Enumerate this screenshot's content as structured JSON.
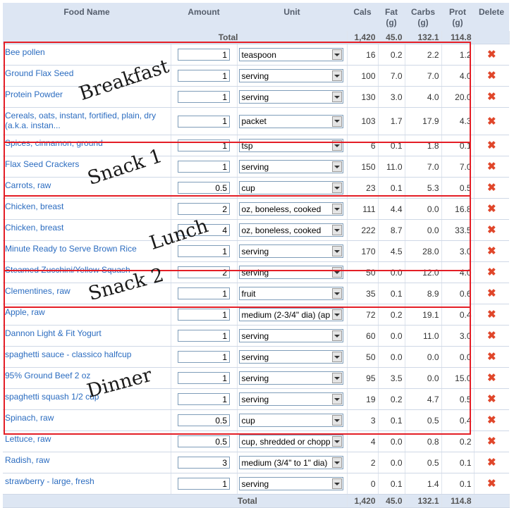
{
  "headers": {
    "food_name": "Food Name",
    "amount": "Amount",
    "unit": "Unit",
    "cals": "Cals",
    "fat": "Fat",
    "fat_unit": "(g)",
    "carbs": "Carbs",
    "carbs_unit": "(g)",
    "prot": "Prot",
    "prot_unit": "(g)",
    "delete": "Delete"
  },
  "total": {
    "label": "Total",
    "cals": "1,420",
    "fat": "45.0",
    "carbs": "132.1",
    "prot": "114.8"
  },
  "groups": {
    "breakfast": "Breakfast",
    "snack1": "Snack 1",
    "lunch": "Lunch",
    "snack2": "Snack 2",
    "dinner": "Dinner"
  },
  "rows": [
    {
      "name": "Bee pollen",
      "amount": "1",
      "unit": "teaspoon",
      "cals": "16",
      "fat": "0.2",
      "carbs": "2.2",
      "prot": "1.2"
    },
    {
      "name": "Ground Flax Seed",
      "amount": "1",
      "unit": "serving",
      "cals": "100",
      "fat": "7.0",
      "carbs": "7.0",
      "prot": "4.0"
    },
    {
      "name": "Protein Powder",
      "amount": "1",
      "unit": "serving",
      "cals": "130",
      "fat": "3.0",
      "carbs": "4.0",
      "prot": "20.0"
    },
    {
      "name": "Cereals, oats, instant, fortified, plain, dry (a.k.a. instan...",
      "amount": "1",
      "unit": "packet",
      "cals": "103",
      "fat": "1.7",
      "carbs": "17.9",
      "prot": "4.3"
    },
    {
      "name": "Spices, cinnamon, ground",
      "amount": "1",
      "unit": "tsp",
      "cals": "6",
      "fat": "0.1",
      "carbs": "1.8",
      "prot": "0.1"
    },
    {
      "name": "Flax Seed Crackers",
      "amount": "1",
      "unit": "serving",
      "cals": "150",
      "fat": "11.0",
      "carbs": "7.0",
      "prot": "7.0"
    },
    {
      "name": "Carrots, raw",
      "amount": "0.5",
      "unit": "cup",
      "cals": "23",
      "fat": "0.1",
      "carbs": "5.3",
      "prot": "0.5"
    },
    {
      "name": "Chicken, breast",
      "amount": "2",
      "unit": "oz, boneless, cooked",
      "cals": "111",
      "fat": "4.4",
      "carbs": "0.0",
      "prot": "16.8"
    },
    {
      "name": "Chicken, breast",
      "amount": "4",
      "unit": "oz, boneless, cooked",
      "cals": "222",
      "fat": "8.7",
      "carbs": "0.0",
      "prot": "33.5"
    },
    {
      "name": "Minute Ready to Serve Brown Rice",
      "amount": "1",
      "unit": "serving",
      "cals": "170",
      "fat": "4.5",
      "carbs": "28.0",
      "prot": "3.0"
    },
    {
      "name": "Steamed Zucchini/Yellow Squash",
      "amount": "2",
      "unit": "serving",
      "cals": "50",
      "fat": "0.0",
      "carbs": "12.0",
      "prot": "4.0"
    },
    {
      "name": "Clementines, raw",
      "amount": "1",
      "unit": "fruit",
      "cals": "35",
      "fat": "0.1",
      "carbs": "8.9",
      "prot": "0.6"
    },
    {
      "name": "Apple, raw",
      "amount": "1",
      "unit": "medium (2-3/4\" dia) (ap",
      "cals": "72",
      "fat": "0.2",
      "carbs": "19.1",
      "prot": "0.4"
    },
    {
      "name": "Dannon Light & Fit Yogurt",
      "amount": "1",
      "unit": "serving",
      "cals": "60",
      "fat": "0.0",
      "carbs": "11.0",
      "prot": "3.0"
    },
    {
      "name": "spaghetti sauce - classico halfcup",
      "amount": "1",
      "unit": "serving",
      "cals": "50",
      "fat": "0.0",
      "carbs": "0.0",
      "prot": "0.0"
    },
    {
      "name": "95% Ground Beef 2 oz",
      "amount": "1",
      "unit": "serving",
      "cals": "95",
      "fat": "3.5",
      "carbs": "0.0",
      "prot": "15.0"
    },
    {
      "name": "spaghetti squash 1/2 cup",
      "amount": "1",
      "unit": "serving",
      "cals": "19",
      "fat": "0.2",
      "carbs": "4.7",
      "prot": "0.5"
    },
    {
      "name": "Spinach, raw",
      "amount": "0.5",
      "unit": "cup",
      "cals": "3",
      "fat": "0.1",
      "carbs": "0.5",
      "prot": "0.4"
    },
    {
      "name": "Lettuce, raw",
      "amount": "0.5",
      "unit": "cup, shredded or chopp",
      "cals": "4",
      "fat": "0.0",
      "carbs": "0.8",
      "prot": "0.2"
    },
    {
      "name": "Radish, raw",
      "amount": "3",
      "unit": "medium (3/4\" to 1\" dia)",
      "cals": "2",
      "fat": "0.0",
      "carbs": "0.5",
      "prot": "0.1"
    },
    {
      "name": "strawberry - large, fresh",
      "amount": "1",
      "unit": "serving",
      "cals": "0",
      "fat": "0.1",
      "carbs": "1.4",
      "prot": "0.1"
    }
  ],
  "colors": {
    "link": "#2b6cc0",
    "header_bg": "#dde6f3",
    "annotation_border": "#e41e26",
    "delete_icon": "#e0462a"
  },
  "icons": {
    "delete": "close-icon",
    "dropdown": "chevron-down-icon"
  }
}
